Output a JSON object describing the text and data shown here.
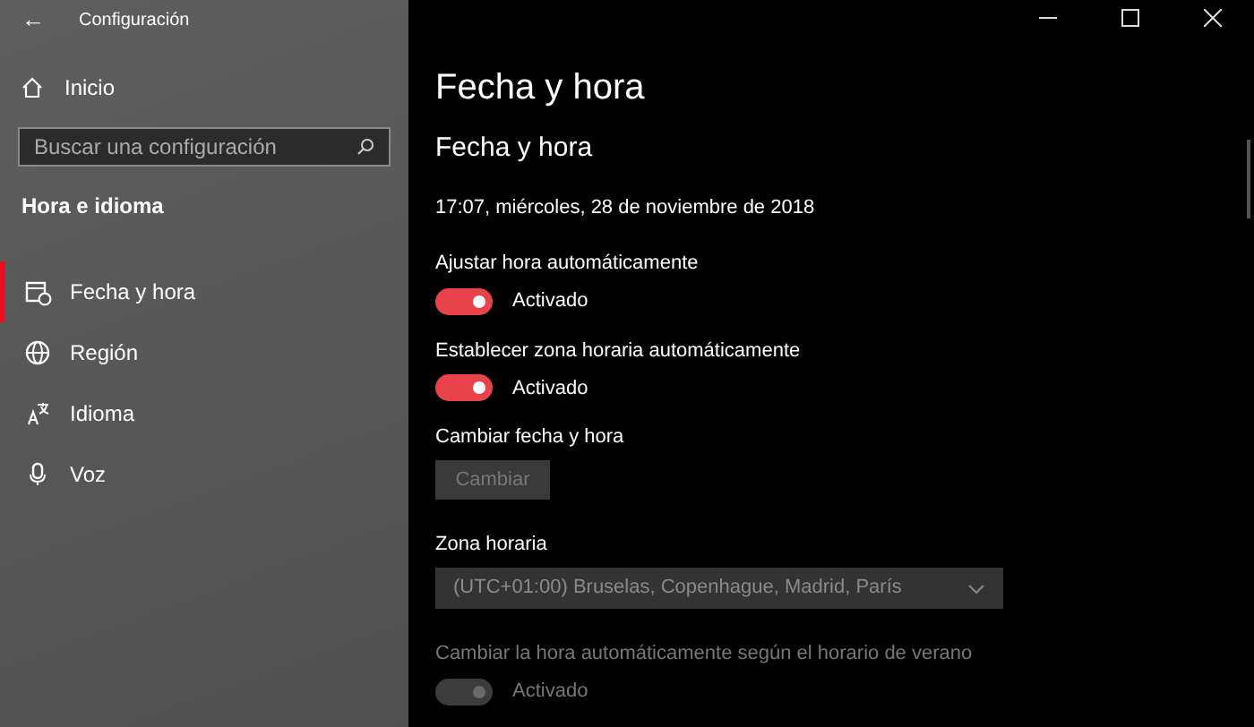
{
  "window": {
    "title": "Configuración",
    "back": "←"
  },
  "sidebar": {
    "home": "Inicio",
    "search": {
      "placeholder": "Buscar una configuración"
    },
    "section": "Hora e idioma",
    "items": [
      {
        "label": "Fecha y hora",
        "kind": "calendar",
        "selected": true
      },
      {
        "label": "Región",
        "kind": "globe",
        "selected": false
      },
      {
        "label": "Idioma",
        "kind": "language",
        "selected": false
      },
      {
        "label": "Voz",
        "kind": "mic",
        "selected": false
      }
    ]
  },
  "page": {
    "title": "Fecha y hora",
    "section": "Fecha y hora",
    "current": "17:07, miércoles, 28 de noviembre de 2018",
    "settings": [
      {
        "kind": "toggle",
        "label": "Ajustar hora automáticamente",
        "on": true,
        "disabled": false,
        "state": "Activado"
      },
      {
        "kind": "toggle",
        "label": "Establecer zona horaria automáticamente",
        "on": true,
        "disabled": false,
        "state": "Activado"
      },
      {
        "kind": "button",
        "label": "Cambiar fecha y hora",
        "button": "Cambiar",
        "disabled": true
      },
      {
        "kind": "dropdown",
        "label": "Zona horaria",
        "value": "(UTC+01:00) Bruselas, Copenhague, Madrid, París",
        "disabled": true
      },
      {
        "kind": "toggle",
        "label": "Cambiar la hora automáticamente según el horario de verano",
        "on": true,
        "disabled": true,
        "state": "Activado"
      }
    ]
  }
}
